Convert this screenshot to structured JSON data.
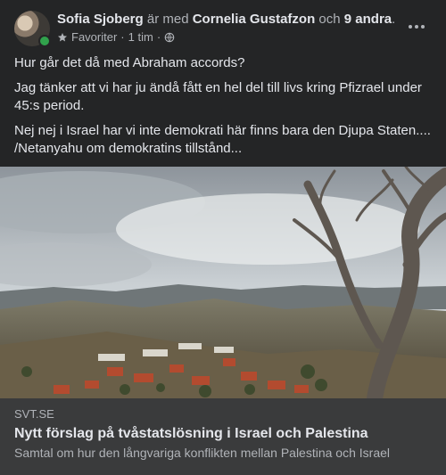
{
  "colors": {
    "background": "#242526",
    "link_box": "#3a3b3c",
    "primary_text": "#e4e6eb",
    "secondary_text": "#b0b3b8",
    "online": "#31a24c"
  },
  "header": {
    "author": "Sofia Sjoberg",
    "with_text": "är med",
    "tagged_person": "Cornelia Gustafzon",
    "and_text": "och",
    "others": "9 andra",
    "end_punct": ".",
    "favorite_icon": "star-icon",
    "favorite_label": "Favoriter",
    "separator": "·",
    "time": "1 tim",
    "audience_icon": "globe-icon",
    "more_icon": "more-horizontal-icon"
  },
  "post": {
    "paragraphs": [
      "Hur går det då med Abraham accords?",
      "Jag tänker att vi har ju ändå fått en hel del till livs kring Pfizrael under 45:s period.",
      "Nej nej i Israel har vi inte demokrati här finns bara den Djupa Staten.... /Netanyahu om demokratins tillstånd..."
    ]
  },
  "link_preview": {
    "source": "SVT.SE",
    "title": "Nytt förslag på tvåstatslösning i Israel och Palestina",
    "description": "Samtal om hur den långvariga konflikten mellan Palestina och Israel"
  }
}
